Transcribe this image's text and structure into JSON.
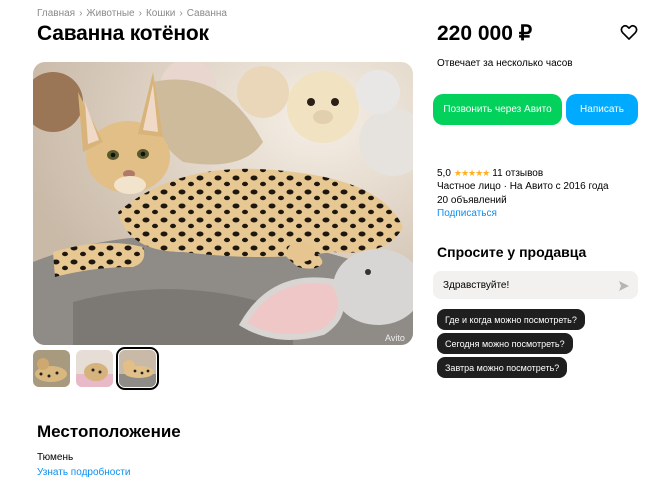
{
  "breadcrumb": [
    "Главная",
    "Животные",
    "Кошки",
    "Саванна"
  ],
  "listing": {
    "title": "Саванна котёнок",
    "price": "220 000 ₽",
    "response_time": "Отвечает за несколько часов"
  },
  "actions": {
    "call_label": "Позвонить через Авито",
    "write_label": "Написать"
  },
  "seller": {
    "rating": "5,0",
    "stars": "★★★★★",
    "reviews": "11 отзывов",
    "info": "Частное лицо · На Авито с 2016 года",
    "ads_count": "20 объявлений",
    "subscribe_label": "Подписаться"
  },
  "ask": {
    "title": "Спросите у продавца",
    "input_value": "Здравствуйте!",
    "questions": [
      "Где и когда можно посмотреть?",
      "Сегодня можно посмотреть?",
      "Завтра можно посмотреть?"
    ]
  },
  "location": {
    "title": "Местоположение",
    "city": "Тюмень",
    "details_link": "Узнать подробности"
  },
  "photo": {
    "watermark": "Avito",
    "thumbnail_count": 3,
    "active_thumbnail": 3
  },
  "icons": {
    "favorite": "heart-icon",
    "send": "send-arrow-icon"
  },
  "colors": {
    "call_button": "#02d15c",
    "write_button": "#00aaff",
    "link": "#0a8ff0",
    "star": "#ffb021",
    "chip": "#1f1f1f"
  }
}
